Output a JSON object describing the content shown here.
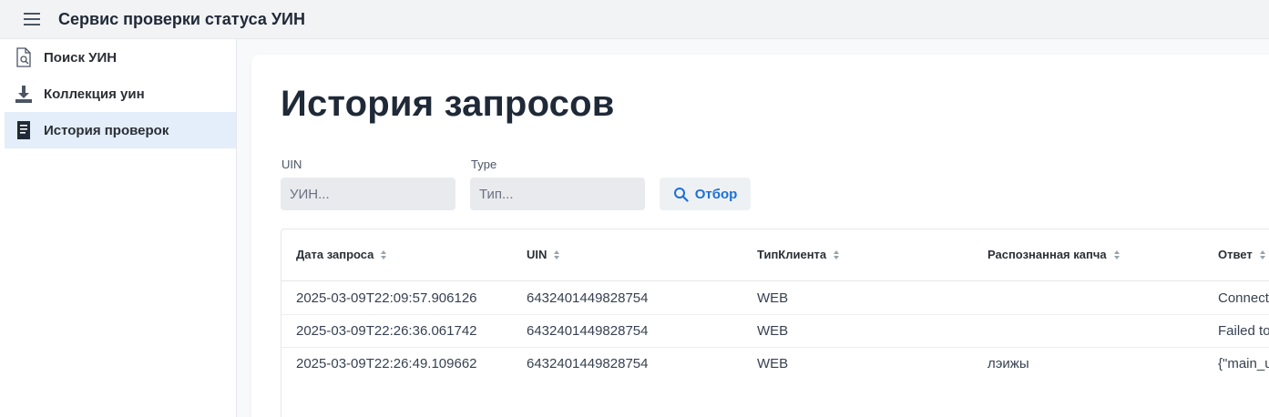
{
  "header": {
    "title": "Сервис проверки статуса УИН"
  },
  "sidebar": {
    "items": [
      {
        "label": "Поиск УИН",
        "icon": "document-search-icon"
      },
      {
        "label": "Коллекция уин",
        "icon": "download-tray-icon"
      },
      {
        "label": "История проверок",
        "icon": "document-icon",
        "active": true
      }
    ]
  },
  "main": {
    "title": "История запросов",
    "filters": {
      "uin": {
        "label": "UIN",
        "placeholder": "УИН..."
      },
      "type": {
        "label": "Type",
        "placeholder": "Тип..."
      },
      "button_label": "Отбор"
    },
    "table": {
      "columns": [
        "Дата запроса",
        "UIN",
        "ТипКлиента",
        "Распознанная капча",
        "Ответ"
      ],
      "rows": [
        [
          "2025-03-09T22:09:57.906126",
          "6432401449828754",
          "WEB",
          "",
          "Connect"
        ],
        [
          "2025-03-09T22:26:36.061742",
          "6432401449828754",
          "WEB",
          "",
          "Failed to"
        ],
        [
          "2025-03-09T22:26:49.109662",
          "6432401449828754",
          "WEB",
          "лэижы",
          "{\"main_u"
        ]
      ]
    }
  },
  "colors": {
    "accent": "#1d6fd6",
    "active_nav_bg": "#e3eefa",
    "header_bg": "#f2f3f5"
  }
}
